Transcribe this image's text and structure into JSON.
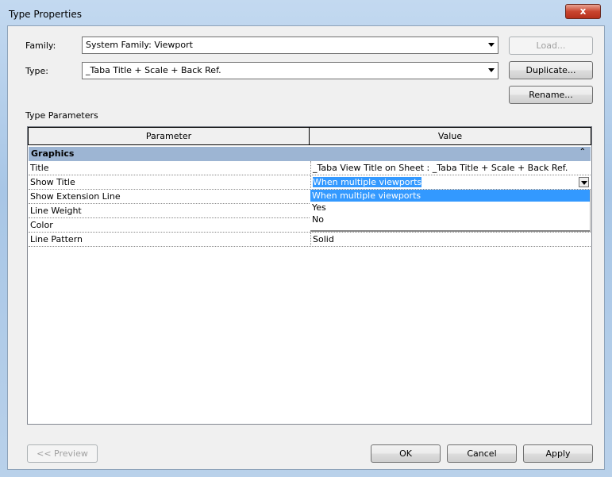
{
  "window": {
    "title": "Type Properties",
    "close_label": "x"
  },
  "family": {
    "label": "Family:",
    "value": "System Family: Viewport"
  },
  "type": {
    "label": "Type:",
    "value": "_Taba Title + Scale + Back Ref."
  },
  "buttons": {
    "load": "Load...",
    "duplicate": "Duplicate...",
    "rename": "Rename...",
    "preview": "<< Preview",
    "ok": "OK",
    "cancel": "Cancel",
    "apply": "Apply"
  },
  "type_parameters_label": "Type Parameters",
  "table": {
    "headers": [
      "Parameter",
      "Value"
    ],
    "group": "Graphics",
    "collapse_icon": "double-chevron-up-icon",
    "rows": [
      {
        "p": "Title",
        "v": "_Taba View Title on Sheet : _Taba Title + Scale + Back Ref."
      },
      {
        "p": "Show Title",
        "v": "When multiple viewports"
      },
      {
        "p": "Show Extension Line",
        "v": ""
      },
      {
        "p": "Line Weight",
        "v": ""
      },
      {
        "p": "Color",
        "v": ""
      },
      {
        "p": "Line Pattern",
        "v": "Solid"
      }
    ]
  },
  "dropdown": {
    "options": [
      "When multiple viewports",
      "Yes",
      "No"
    ],
    "selected": "When multiple viewports"
  }
}
